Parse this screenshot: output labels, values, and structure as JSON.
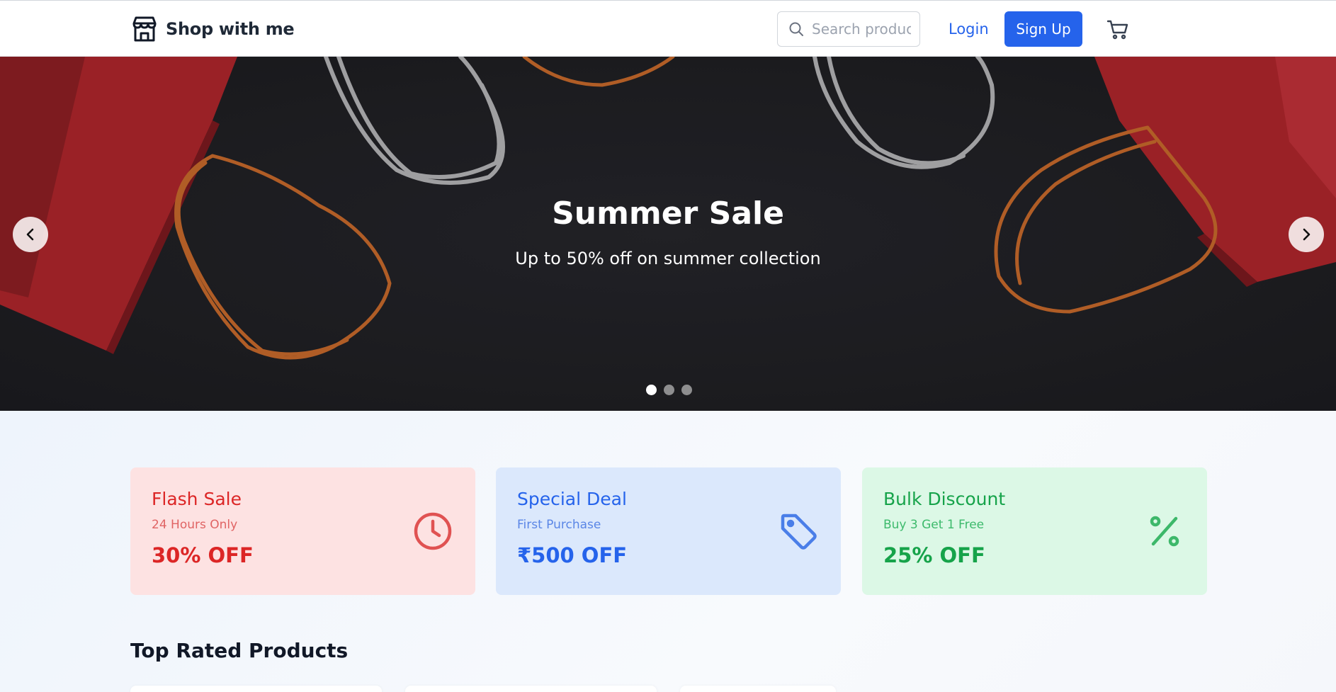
{
  "header": {
    "brand": "Shop with me",
    "search_placeholder": "Search products...",
    "login_label": "Login",
    "signup_label": "Sign Up",
    "icons": {
      "brand": "store-icon",
      "search": "search-icon",
      "cart": "cart-icon"
    }
  },
  "hero": {
    "title": "Summer Sale",
    "subtitle": "Up to 50% off on summer collection",
    "slides_total": 3,
    "active_slide": 1
  },
  "offers": [
    {
      "title": "Flash Sale",
      "subtitle": "24 Hours Only",
      "value": "30% OFF",
      "icon": "clock-icon",
      "color": "#dc2626"
    },
    {
      "title": "Special Deal",
      "subtitle": "First Purchase",
      "value": "₹500 OFF",
      "icon": "tag-icon",
      "color": "#2563eb"
    },
    {
      "title": "Bulk Discount",
      "subtitle": "Buy 3 Get 1 Free",
      "value": "25% OFF",
      "icon": "percent-icon",
      "color": "#16a34a"
    }
  ],
  "products_section": {
    "title": "Top Rated Products"
  }
}
